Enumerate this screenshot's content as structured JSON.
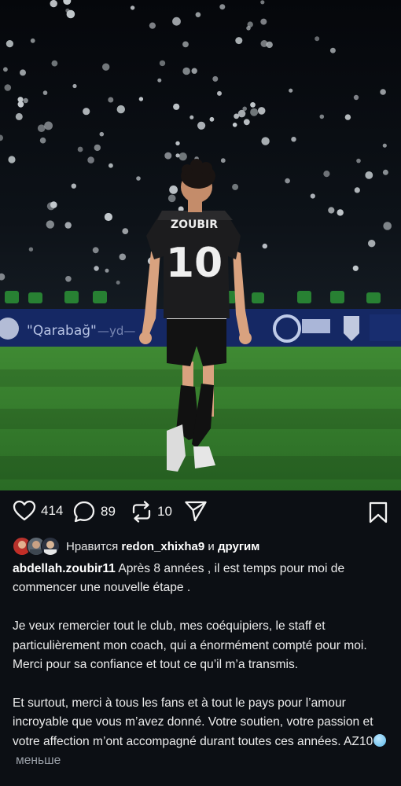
{
  "post": {
    "image": {
      "description": "jersey-name-and-number",
      "jersey_name": "ZOUBIR",
      "jersey_number": "10"
    },
    "actions": {
      "like_count": "414",
      "comment_count": "89",
      "repost_count": "10",
      "icons": {
        "like": "heart-icon",
        "comment": "comment-bubble-icon",
        "repost": "repost-icon",
        "share": "send-icon",
        "save": "bookmark-icon"
      }
    },
    "likes": {
      "prefix": "Нравится",
      "user": "redon_xhixha9",
      "conjunction": "и",
      "others": "другим"
    },
    "caption": {
      "username": "abdellah.zoubir11",
      "line1": "Après 8 années , il est temps pour moi de commencer une nouvelle étape .",
      "para2": "Je veux remercier tout le club, mes coéquipiers, le staff et particulièrement mon coach, qui a énormément compté pour moi. Merci pour sa confiance et tout ce qu’il m’a transmis.",
      "para3": "Et surtout, merci à tous les fans et à tout le pays pour l’amour incroyable que vous m’avez donné. Votre soutien, votre passion et votre affection m’ont accompagné durant toutes ces années.",
      "signature": "AZ10",
      "emoji": "smiling-face-with-tear-emoji",
      "less_label": "меньше"
    },
    "colors": {
      "background": "#0c0f14",
      "text": "#f2f2f2",
      "muted": "#9aa0a8",
      "pitch": "#2f7a2b"
    }
  }
}
